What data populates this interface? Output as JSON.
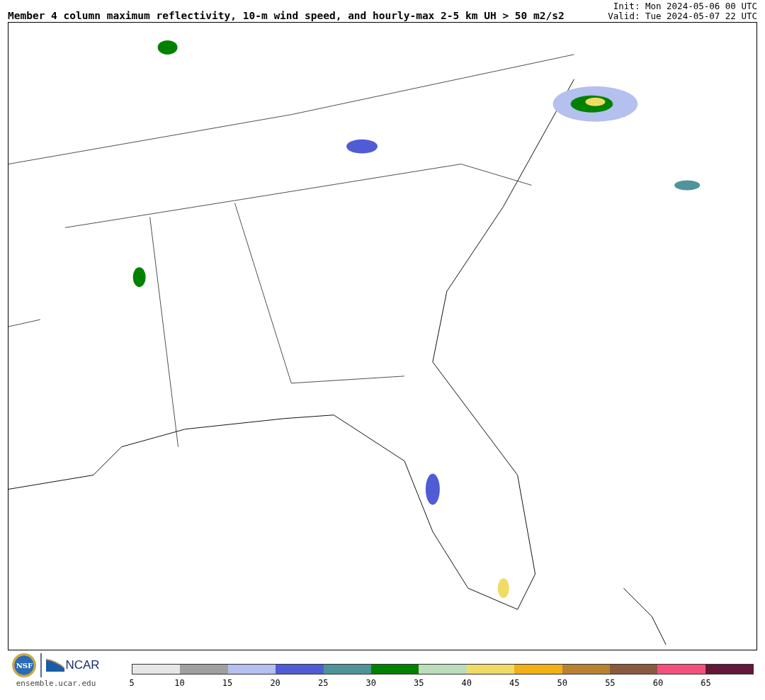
{
  "title": "Member 4 column maximum reflectivity, 10-m wind speed, and hourly-max 2-5 km UH > 50 m2/s2",
  "init": "Init: Mon 2024-05-06 00 UTC",
  "valid": "Valid: Tue 2024-05-07 22 UTC",
  "logos": {
    "nsf": "NSF",
    "ncar": "NCAR",
    "site": "ensemble.ucar.edu"
  },
  "colorbar": {
    "segments": [
      {
        "color": "#e6e6e6"
      },
      {
        "color": "#a0a0a0"
      },
      {
        "color": "#b4c0ee"
      },
      {
        "color": "#505bd6"
      },
      {
        "color": "#4f9499"
      },
      {
        "color": "#008200"
      },
      {
        "color": "#bcdcbc"
      },
      {
        "color": "#f0dc64"
      },
      {
        "color": "#f0b016"
      },
      {
        "color": "#b88232"
      },
      {
        "color": "#8a5a3e"
      },
      {
        "color": "#f4507e"
      },
      {
        "color": "#621838"
      }
    ],
    "ticks": [
      "5",
      "10",
      "15",
      "20",
      "25",
      "30",
      "35",
      "40",
      "45",
      "50",
      "55",
      "60",
      "65"
    ]
  }
}
